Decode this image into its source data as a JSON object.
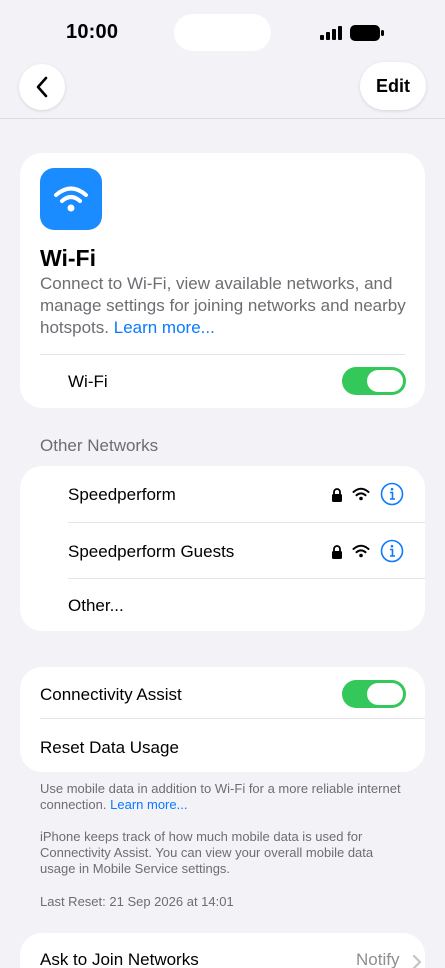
{
  "status_bar": {
    "time": "10:00"
  },
  "nav": {
    "edit_label": "Edit"
  },
  "wifi": {
    "title": "Wi-Fi",
    "description": "Connect to Wi-Fi, view available networks, and manage settings for joining networks and nearby hotspots.",
    "learn_more": "Learn more...",
    "toggle_label": "Wi-Fi",
    "toggle_on": true
  },
  "other_networks": {
    "header": "Other Networks",
    "items": [
      {
        "name": "Speedperform",
        "secured": true
      },
      {
        "name": "Speedperform Guests",
        "secured": true
      },
      {
        "name": "Other..."
      }
    ]
  },
  "assist": {
    "label": "Connectivity Assist",
    "toggle_on": true,
    "reset_label": "Reset Data Usage",
    "note1": "Use mobile data in addition to Wi-Fi for a more reliable internet connection.",
    "note1_link": "Learn more...",
    "note2": "iPhone keeps track of how much mobile data is used for Connectivity Assist. You can view your overall mobile data usage in Mobile Service settings.",
    "last_reset": "Last Reset: 21 Sep 2026 at 14:01"
  },
  "ask_join": {
    "label": "Ask to Join Networks",
    "value": "Notify"
  },
  "colors": {
    "accent": "#0a7aff",
    "toggle_on": "#34c759",
    "wifi_icon_bg": "#1a8cff"
  }
}
